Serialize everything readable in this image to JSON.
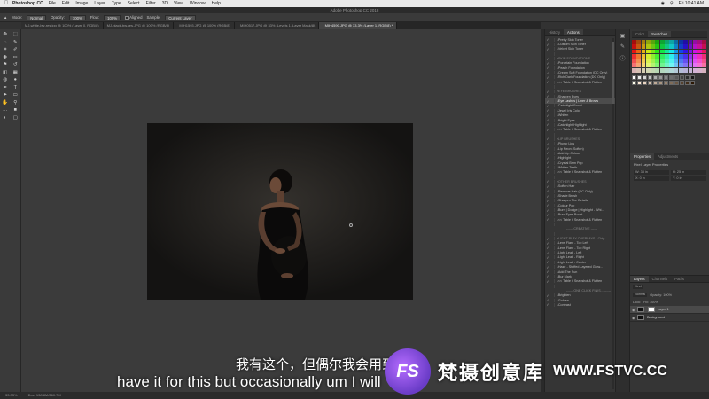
{
  "menubar": {
    "app_name": "Photoshop CC",
    "items": [
      "File",
      "Edit",
      "Image",
      "Layer",
      "Type",
      "Select",
      "Filter",
      "3D",
      "View",
      "Window",
      "Help"
    ],
    "clock": "Fri 10:41 AM"
  },
  "window_title": "Adobe Photoshop CC 2018",
  "options_bar": {
    "mode_label": "Mode:",
    "mode_value": "Normal",
    "opacity_label": "Opacity:",
    "opacity_value": "100%",
    "flow_label": "Flow:",
    "flow_value": "100%",
    "aligned_label": "Aligned",
    "sample_label": "Sample:",
    "sample_value": "Current Layer"
  },
  "tabs": [
    {
      "label": "MJ-white-bw-res.jpg @ 100% (Layer 0, RGB/8)",
      "active": false
    },
    {
      "label": "MJ-black-bw-res.JPG @ 100% (RGB/8)",
      "active": false
    },
    {
      "label": "_MIH1593.JPG @ 100% (RGB/8)",
      "active": false
    },
    {
      "label": "_MIH0517.JPG @ 33% (Levels 1, Layer Mask/8)",
      "active": false
    },
    {
      "label": "_MIH4590.JPG @ 33.3% (Layer 1, RGB/8) *",
      "active": true
    }
  ],
  "tools": [
    "move",
    "marquee",
    "lasso",
    "quick-select",
    "crop",
    "eyedropper",
    "healing",
    "brush",
    "stamp",
    "history-brush",
    "eraser",
    "gradient",
    "blur",
    "dodge",
    "pen",
    "type",
    "path-select",
    "shape",
    "hand",
    "zoom",
    "more",
    "colors",
    "quick-mask",
    "screen-mode"
  ],
  "actions_panel": {
    "tabs": [
      "History",
      "Actions"
    ],
    "rows": [
      {
        "label": "Pretty Skin Toner",
        "type": "action"
      },
      {
        "label": "Custom Skin Toner",
        "type": "action"
      },
      {
        "label": "Velvet Skin Toner",
        "type": "action"
      },
      {
        "label": "",
        "type": "blank"
      },
      {
        "label": "SKIN FOUNDATIONS",
        "type": "set"
      },
      {
        "label": "Porcelain Foundation",
        "type": "action"
      },
      {
        "label": "Peach Foundation",
        "type": "action"
      },
      {
        "label": "Cream Soft Foundation (DC Only)",
        "type": "action"
      },
      {
        "label": "Rich Dark Foundation (DC Only)",
        "type": "action"
      },
      {
        "label": "<< Table it Snapshot & Flatten",
        "type": "action"
      },
      {
        "label": "",
        "type": "blank"
      },
      {
        "label": "EYE BRUSHES",
        "type": "set"
      },
      {
        "label": "Sharpen Eyes",
        "type": "action"
      },
      {
        "label": "Eye Lashes | Liner & Brows",
        "type": "selected"
      },
      {
        "label": "Catchlight Boost",
        "type": "action"
      },
      {
        "label": "Jewel Iris Color",
        "type": "action"
      },
      {
        "label": "Whiten",
        "type": "action"
      },
      {
        "label": "Bright Eyes",
        "type": "action"
      },
      {
        "label": "Catchlight Highlight",
        "type": "action"
      },
      {
        "label": "<< Table it Snapshot & Flatten",
        "type": "action"
      },
      {
        "label": "",
        "type": "blank"
      },
      {
        "label": "LIP BRUSHES",
        "type": "set"
      },
      {
        "label": "Plump Lips",
        "type": "action"
      },
      {
        "label": "Lip Neon (Soften)",
        "type": "action"
      },
      {
        "label": "Add Lip Colour",
        "type": "action"
      },
      {
        "label": "Highlight",
        "type": "action"
      },
      {
        "label": "Crystal Brim Pop",
        "type": "action"
      },
      {
        "label": "Whiten Teeth",
        "type": "action"
      },
      {
        "label": "<< Table it Snapshot & Flatten",
        "type": "action"
      },
      {
        "label": "",
        "type": "blank"
      },
      {
        "label": "OTHER BRUSHES",
        "type": "set"
      },
      {
        "label": "Soften Hair",
        "type": "action"
      },
      {
        "label": "Remove Hair (DC Only)",
        "type": "action"
      },
      {
        "label": "Shade Brush",
        "type": "action"
      },
      {
        "label": "Sharpen The Details",
        "type": "action"
      },
      {
        "label": "Colour Pop",
        "type": "action"
      },
      {
        "label": "Burn | Dodge | Highlight - Whi...",
        "type": "action"
      },
      {
        "label": "Burn Eyes Boost",
        "type": "action"
      },
      {
        "label": "<< Table it Snapshot & Flatten",
        "type": "action"
      },
      {
        "label": "",
        "type": "blank"
      },
      {
        "label": "------ CREATIVE ------",
        "type": "divider"
      },
      {
        "label": "",
        "type": "blank"
      },
      {
        "label": "LIGHT PLAY OVERLAYS - Chip...",
        "type": "set"
      },
      {
        "label": "Lens Flare - Top Left",
        "type": "action"
      },
      {
        "label": "Lens Flare - Top Right",
        "type": "action"
      },
      {
        "label": "Light Leak - Left",
        "type": "action"
      },
      {
        "label": "Light Leak - Right",
        "type": "action"
      },
      {
        "label": "Light Leak - Center",
        "type": "action"
      },
      {
        "label": "Haze - Stuffed Layered Glow...",
        "type": "action"
      },
      {
        "label": "Add The Sun",
        "type": "action"
      },
      {
        "label": "Bur Mark",
        "type": "action"
      },
      {
        "label": "<< Table it Snapshot & Flatten",
        "type": "action"
      },
      {
        "label": "",
        "type": "blank"
      },
      {
        "label": "------ ONE CLICK FINIS... ------",
        "type": "divider"
      },
      {
        "label": "Brighten",
        "type": "action"
      },
      {
        "label": "Golden",
        "type": "action"
      },
      {
        "label": "Contrast",
        "type": "action"
      }
    ]
  },
  "right_panels": {
    "color_tabs": [
      "Color",
      "Swatches"
    ],
    "properties_tabs": [
      "Properties",
      "Adjustments"
    ],
    "properties_title": "Pixel Layer Properties",
    "properties_fields": [
      "W: 38 in",
      "H: 25 in",
      "X: 0 in",
      "Y: 0 in"
    ],
    "layers_tabs": [
      "Layers",
      "Channels",
      "Paths"
    ],
    "layers_filter": "Kind",
    "layers_mode": "Normal",
    "layers_opacity": "Opacity: 100%",
    "layers_fill": "Fill: 100%",
    "layers_lock": "Lock:",
    "layers": [
      {
        "name": "Layer 1",
        "selected": true,
        "mask": true
      },
      {
        "name": "Background",
        "selected": false,
        "mask": false
      }
    ]
  },
  "statusbar": {
    "zoom": "33.33%",
    "doc": "Doc: 138.8M/260.7M"
  },
  "subtitles": {
    "chinese": "我有这个，但偶尔我会用到",
    "english": "have it for this but occasionally um I will"
  },
  "watermark": {
    "logo": "FS",
    "brand": "梵摄创意库",
    "url": "WWW.FSTVC.CC"
  },
  "colors": {
    "accent": "#b56cff"
  }
}
